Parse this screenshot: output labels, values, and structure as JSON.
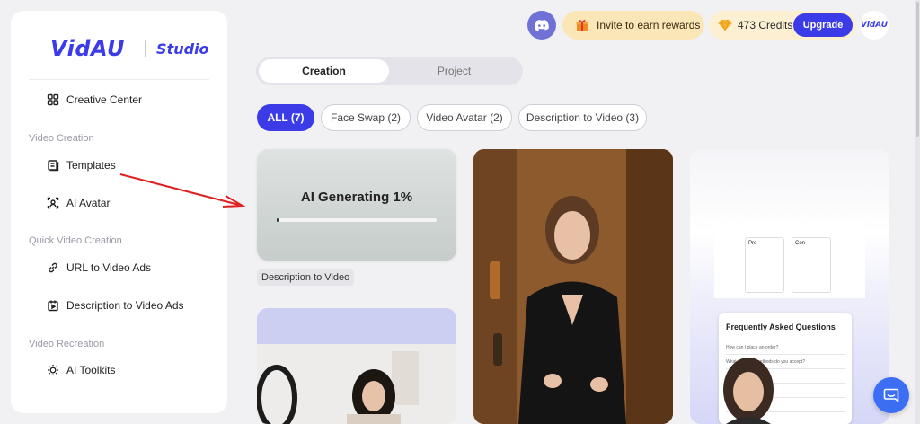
{
  "sidebar": {
    "logo": "VidAU",
    "product": "Studio",
    "creative_center": "Creative Center",
    "sections": {
      "video_creation": "Video Creation",
      "quick_video_creation": "Quick Video Creation",
      "video_recreation": "Video Recreation"
    },
    "items": {
      "templates": "Templates",
      "ai_avatar": "AI Avatar",
      "url_to_video_ads": "URL to Video Ads",
      "description_to_video_ads": "Description to Video Ads",
      "ai_toolkits": "AI Toolkits"
    }
  },
  "topbar": {
    "invite": "Invite to earn rewards",
    "credits": "473 Credits",
    "upgrade": "Upgrade",
    "avatar_text": "VidAU"
  },
  "tabs": {
    "creation": "Creation",
    "project": "Project"
  },
  "filters": [
    "ALL (7)",
    "Face Swap (2)",
    "Video Avatar (2)",
    "Description to Video (3)"
  ],
  "cards": {
    "generating": "AI Generating 1%",
    "progress_percent": 1,
    "generating_label": "Description to Video",
    "faq": {
      "title": "Frequently Asked Questions",
      "rows": [
        "How can I place an order?",
        "What payment methods do you accept?",
        "",
        "",
        ""
      ]
    },
    "pros_cons": {
      "pro": "Pro",
      "con": "Con"
    }
  },
  "colors": {
    "accent": "#3b3ce8",
    "annotation_arrow": "#e02020"
  }
}
